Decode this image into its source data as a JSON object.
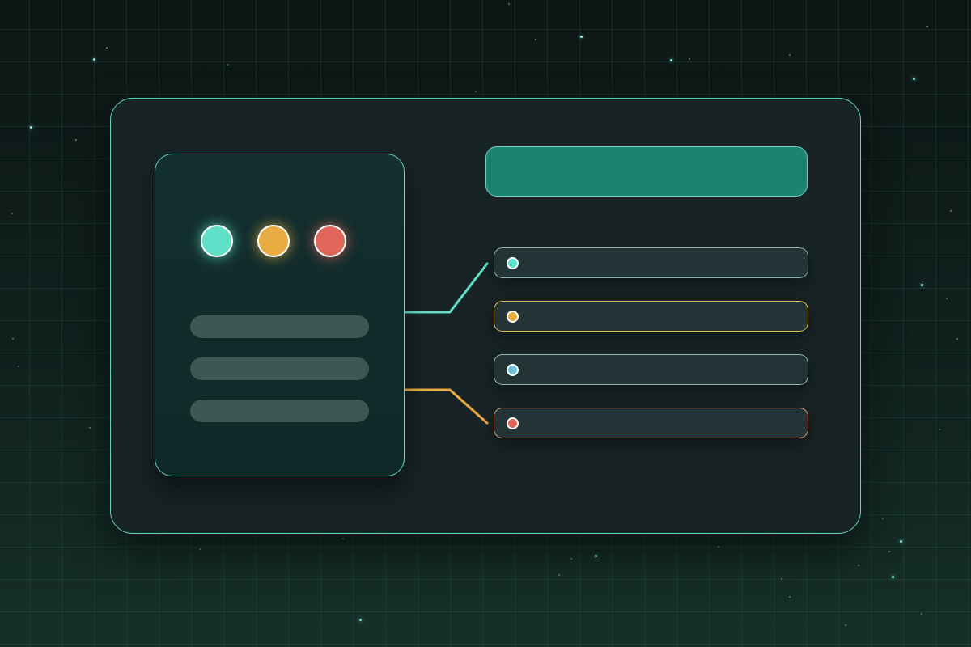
{
  "colors": {
    "accent_teal": "#5fe0c8",
    "accent_amber": "#e8ac42",
    "accent_red": "#e0665a",
    "accent_blue": "#6fc3d6",
    "header_fill": "#1d8272",
    "window_border": "#5fd6c0"
  },
  "status_dots": [
    {
      "name": "teal",
      "color": "#5fe0c8"
    },
    {
      "name": "amber",
      "color": "#e8ac42"
    },
    {
      "name": "red",
      "color": "#e0665a"
    }
  ],
  "list_items": [
    {
      "border_color": "#8fb6b0",
      "bullet_color": "#5fe0c8"
    },
    {
      "border_color": "#e8c260",
      "bullet_color": "#e8ac42"
    },
    {
      "border_color": "#8fb6b0",
      "bullet_color": "#6fc3d6"
    },
    {
      "border_color": "#e89a7e",
      "bullet_color": "#e0665a"
    }
  ],
  "connectors": [
    {
      "color": "#5fe0c8"
    },
    {
      "color": "#e8ac42"
    }
  ]
}
